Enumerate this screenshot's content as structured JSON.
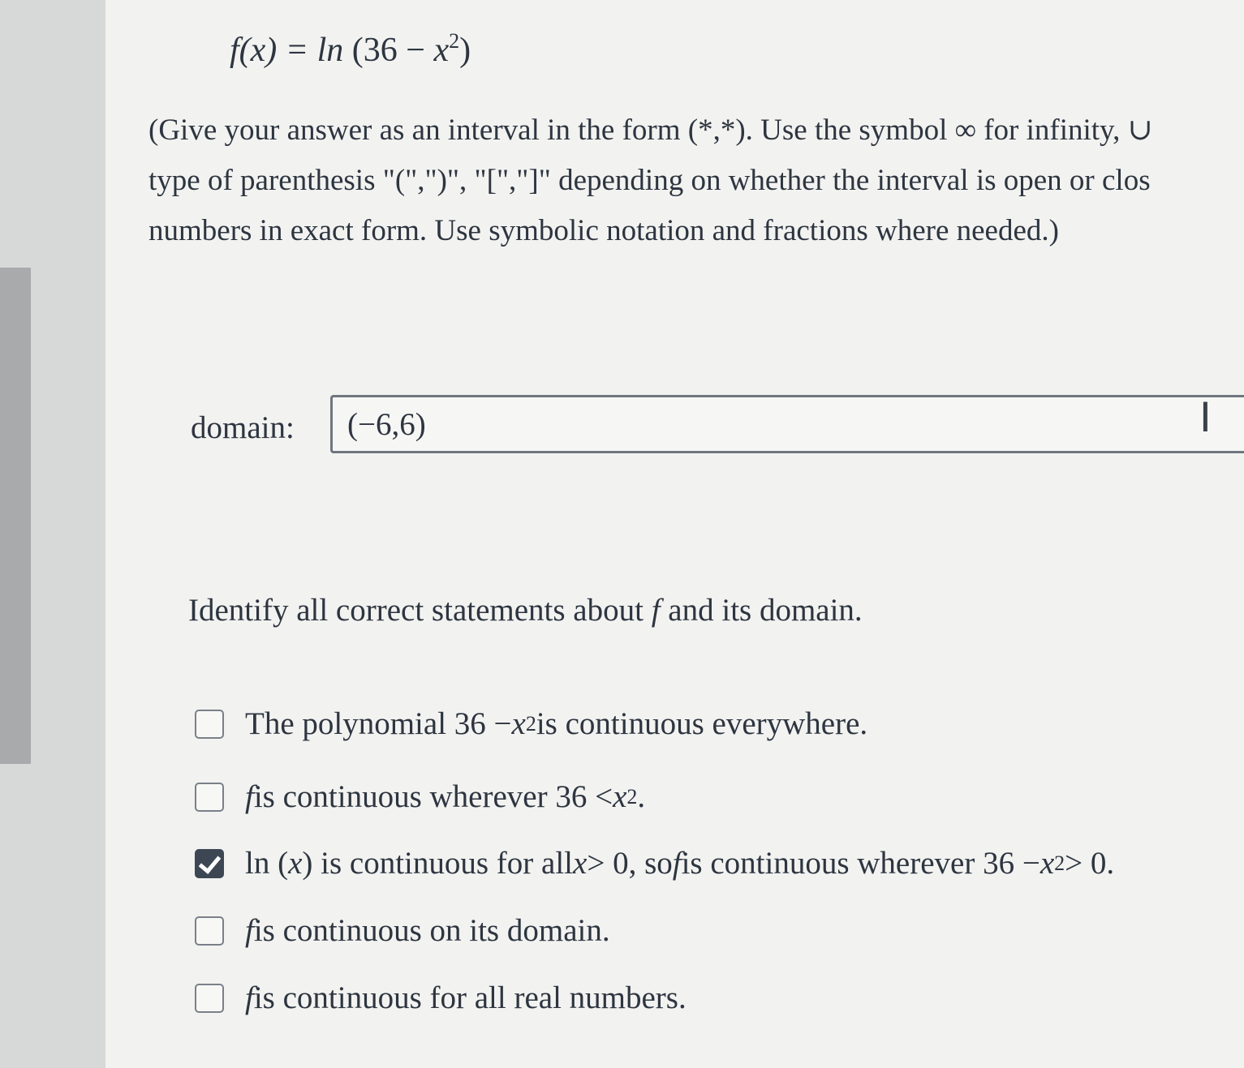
{
  "problem": {
    "formula_lhs": "f(x) = ln",
    "formula_open": "(36 − ",
    "formula_var": "x",
    "formula_exp": "2",
    "formula_close": ")",
    "instructions": [
      "(Give your answer as an interval in the form (*,*). Use the symbol ∞ for infinity, ∪",
      "type of parenthesis \"(\",\")\", \"[\",\"]\" depending on whether the interval is open or clos",
      "numbers in exact form. Use symbolic notation and fractions where needed.)"
    ]
  },
  "domain": {
    "label": "domain:",
    "value": "(−6,6)"
  },
  "question": {
    "before": "Identify all correct statements about ",
    "var": "f",
    "after": " and its domain."
  },
  "options": [
    {
      "checked": false,
      "a": "The polynomial 36 − ",
      "b": "x",
      "c": "2",
      "d": " is continuous everywhere."
    },
    {
      "checked": false,
      "a": "f",
      "b": " is continuous wherever 36 < ",
      "c": "x",
      "d": "2",
      "e": "."
    },
    {
      "checked": true,
      "a": "ln (",
      "b": "x",
      "c": ") is continuous for all ",
      "d": "x",
      "e": " > 0, so ",
      "f": "f",
      "g": " is continuous wherever 36 − ",
      "h": "x",
      "i": "2",
      "j": " > 0."
    },
    {
      "checked": false,
      "a": "f",
      "b": " is continuous on its domain."
    },
    {
      "checked": false,
      "a": "f",
      "b": " is continuous for all real numbers."
    }
  ]
}
